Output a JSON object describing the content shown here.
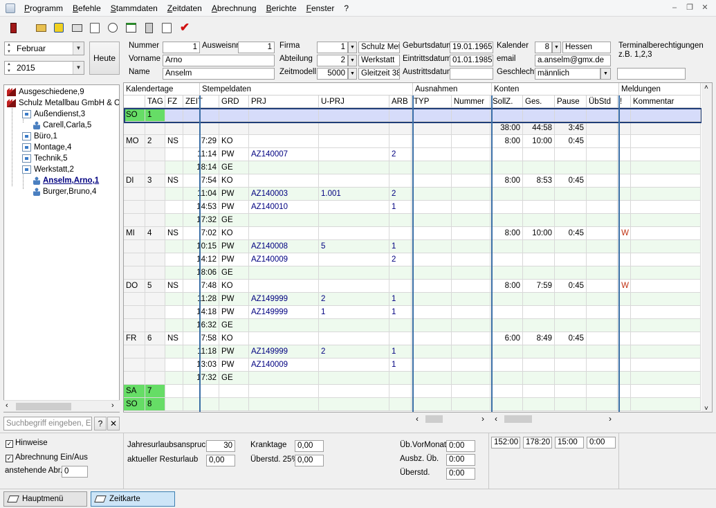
{
  "menu": [
    "Programm",
    "Befehle",
    "Stammdaten",
    "Zeitdaten",
    "Abrechnung",
    "Berichte",
    "Fenster",
    "?"
  ],
  "toolbar_icons": [
    "exit-icon",
    "open-icon",
    "run-icon",
    "print-icon",
    "document-icon",
    "clock-icon",
    "calendar-icon",
    "calculator-icon",
    "report-icon",
    "checkmark-icon"
  ],
  "period": {
    "month": "Februar",
    "year": "2015",
    "today_button": "Heute"
  },
  "employee": {
    "labels": {
      "nummer": "Nummer",
      "ausweisnr": "Ausweisnr",
      "vorname": "Vorname",
      "name": "Name",
      "firma": "Firma",
      "abteilung": "Abteilung",
      "zeitmodell": "Zeitmodell",
      "geburtsdatum": "Geburtsdatum",
      "eintrittsdatum": "Eintrittsdatum",
      "austrittsdatum": "Austrittsdatum",
      "kalender": "Kalender",
      "email": "email",
      "geschlecht": "Geschlecht",
      "terminal": "Terminalberechtigungen",
      "terminal_hint": "z.B. 1,2,3"
    },
    "nummer": "1",
    "ausweisnr": "1",
    "vorname": "Arno",
    "name": "Anselm",
    "firma_nr": "1",
    "firma_name": "Schulz Metal",
    "abteilung_nr": "2",
    "abteilung_name": "Werkstatt",
    "zeitmodell_nr": "5000",
    "zeitmodell_name": "Gleitzeit 38",
    "geburtsdatum": "19.01.1965",
    "eintrittsdatum": "01.01.1985",
    "austrittsdatum": "",
    "kalender_nr": "8",
    "kalender_name": "Hessen",
    "email": "a.anselm@gmx.de",
    "geschlecht": "männlich",
    "terminal": ""
  },
  "tree": [
    {
      "label": "Ausgeschiedene,9",
      "type": "factory",
      "level": 0
    },
    {
      "label": "Schulz Metallbau GmbH & Co.",
      "type": "factory",
      "level": 0
    },
    {
      "label": "Außendienst,3",
      "type": "dept",
      "level": 1
    },
    {
      "label": "Carell,Carla,5",
      "type": "person",
      "level": 2
    },
    {
      "label": "Büro,1",
      "type": "dept",
      "level": 1
    },
    {
      "label": "Montage,4",
      "type": "dept",
      "level": 1
    },
    {
      "label": "Technik,5",
      "type": "dept",
      "level": 1
    },
    {
      "label": "Werkstatt,2",
      "type": "dept",
      "level": 1
    },
    {
      "label": "Anselm,Arno,1",
      "type": "person",
      "level": 2,
      "selected": true
    },
    {
      "label": "Burger,Bruno,4",
      "type": "person",
      "level": 2
    }
  ],
  "grid": {
    "groups": [
      "Kalendertage",
      "Stempeldaten",
      "Ausnahmen",
      "Konten",
      "Meldungen"
    ],
    "columns": [
      "",
      "TAG",
      "FZ",
      "ZEIT",
      "GRD",
      "PRJ",
      "U-PRJ",
      "ARB",
      "TYP",
      "Nummer",
      "SollZ.",
      "Ges.",
      "Pause",
      "ÜbStd",
      "!",
      "Kommentar"
    ],
    "week_totals": {
      "soll": "38:00",
      "ges": "44:58",
      "pause": "3:45"
    },
    "rows": [
      {
        "day": "SO",
        "tag": "1",
        "weekend": true,
        "current": true
      },
      {
        "totals": true
      },
      {
        "day": "MO",
        "tag": "2",
        "fz": "NS",
        "zeit": "7:29",
        "grd": "KO",
        "soll": "8:00",
        "ges": "10:00",
        "pause": "0:45"
      },
      {
        "zeit": "11:14",
        "grd": "PW",
        "prj": "AZ140007",
        "arb": "2"
      },
      {
        "zeit": "18:14",
        "grd": "GE"
      },
      {
        "day": "DI",
        "tag": "3",
        "fz": "NS",
        "zeit": "7:54",
        "grd": "KO",
        "soll": "8:00",
        "ges": "8:53",
        "pause": "0:45"
      },
      {
        "zeit": "11:04",
        "grd": "PW",
        "prj": "AZ140003",
        "uprj": "1.001",
        "arb": "2"
      },
      {
        "zeit": "14:53",
        "grd": "PW",
        "prj": "AZ140010",
        "arb": "1"
      },
      {
        "zeit": "17:32",
        "grd": "GE"
      },
      {
        "day": "MI",
        "tag": "4",
        "fz": "NS",
        "zeit": "7:02",
        "grd": "KO",
        "soll": "8:00",
        "ges": "10:00",
        "pause": "0:45",
        "msg": "W"
      },
      {
        "zeit": "10:15",
        "grd": "PW",
        "prj": "AZ140008",
        "uprj": "5",
        "arb": "1"
      },
      {
        "zeit": "14:12",
        "grd": "PW",
        "prj": "AZ140009",
        "arb": "2"
      },
      {
        "zeit": "18:06",
        "grd": "GE"
      },
      {
        "day": "DO",
        "tag": "5",
        "fz": "NS",
        "zeit": "7:48",
        "grd": "KO",
        "soll": "8:00",
        "ges": "7:59",
        "pause": "0:45",
        "msg": "W"
      },
      {
        "zeit": "11:28",
        "grd": "PW",
        "prj": "AZ149999",
        "uprj": "2",
        "arb": "1"
      },
      {
        "zeit": "14:18",
        "grd": "PW",
        "prj": "AZ149999",
        "uprj": "1",
        "arb": "1"
      },
      {
        "zeit": "16:32",
        "grd": "GE"
      },
      {
        "day": "FR",
        "tag": "6",
        "fz": "NS",
        "zeit": "7:58",
        "grd": "KO",
        "soll": "6:00",
        "ges": "8:49",
        "pause": "0:45"
      },
      {
        "zeit": "11:18",
        "grd": "PW",
        "prj": "AZ149999",
        "uprj": "2",
        "arb": "1"
      },
      {
        "zeit": "13:03",
        "grd": "PW",
        "prj": "AZ140009",
        "arb": "1"
      },
      {
        "zeit": "17:32",
        "grd": "GE"
      },
      {
        "day": "SA",
        "tag": "7",
        "weekend": true
      },
      {
        "day": "SO",
        "tag": "8",
        "weekend": true
      }
    ]
  },
  "search": {
    "placeholder": "Suchbegriff eingeben, Ein",
    "help": "?"
  },
  "bottom": {
    "hinweise": "Hinweise",
    "abrechnung": "Abrechnung Ein/Aus",
    "anstehende_label": "anstehende Abr.",
    "anstehende_value": "0",
    "jahresurlaub_label": "Jahresurlaubsanspruch",
    "jahresurlaub_value": "30",
    "resturlaub_label": "aktueller Resturlaub",
    "resturlaub_value": "0,00",
    "kranktage_label": "Kranktage",
    "kranktage_value": "0,00",
    "ueberstd_label": "Überstd. 25%",
    "ueberstd_value": "0,00",
    "vormonat_label": "Üb.VorMonat",
    "vormonat_value": "0:00",
    "ausbz_label": "Ausbz. Üb.",
    "ausbz_value": "0:00",
    "ueberstd2_label": "Überstd.",
    "ueberstd2_value": "0:00",
    "sum_soll": "152:00",
    "sum_ges": "178:20",
    "sum_pause": "15:00",
    "sum_ub": "0:00"
  },
  "tabs": [
    "Hauptmenü",
    "Zeitkarte"
  ]
}
